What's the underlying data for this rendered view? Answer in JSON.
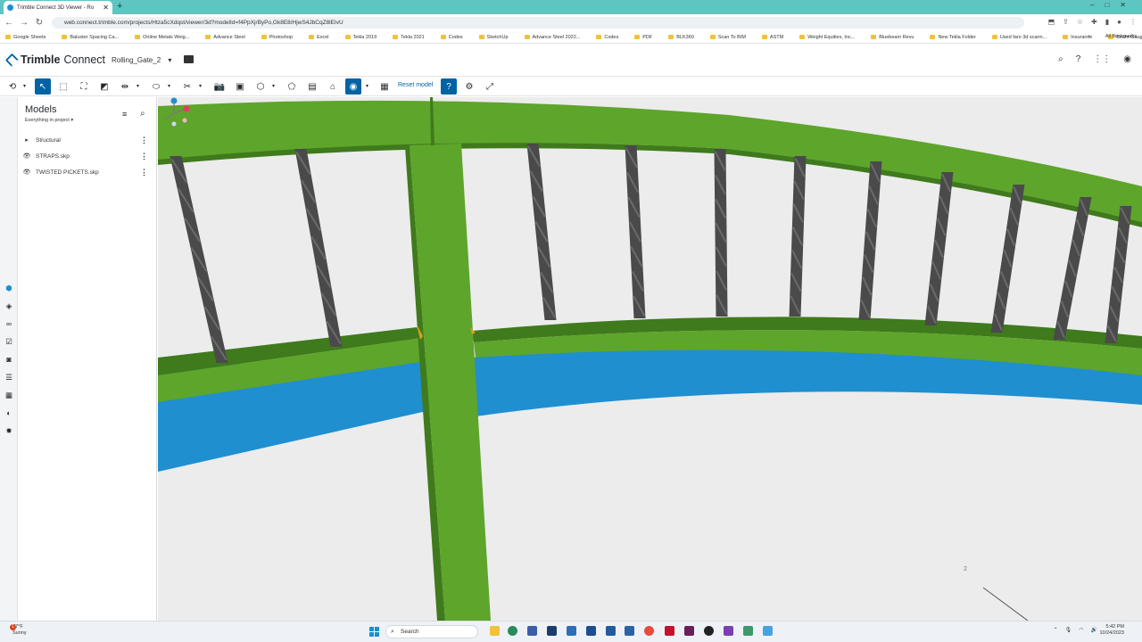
{
  "browser": {
    "tab_title": "Trimble Connect 3D Viewer - Ro",
    "tab_close": "✕",
    "new_tab": "+",
    "url": "web.connect.trimble.com/projects/Htza5cXdqst/viewer/3d?modelId=f4PpXjrByPo,Gk8E8/HjwS4JbCqZ8lEIvU",
    "bookmarks": [
      "Google Sheets",
      "Baluster Spacing Ca...",
      "Online Metals Weig...",
      "Advance Steel",
      "Photoshop",
      "Excel",
      "Tekla 2019",
      "Tekla 2021",
      "Codes",
      "SketchUp",
      "Advance Steel 2022...",
      "Codes",
      "PDF",
      "BLK360",
      "Scan To BIM",
      "ASTM",
      "Weight Equities, Inc...",
      "Bluebeam Revu",
      "New Tekla Folder",
      "Used faro 3d scann...",
      "Insurance",
      "Beam Gauge Lines"
    ],
    "all_bookmarks": "All Bookmarks",
    "bookmark_overflow": "»"
  },
  "app": {
    "brand_bold": "Trimble",
    "brand_rest": "Connect",
    "project_name": "Rolling_Gate_2",
    "project_caret": "▾",
    "reset_model": "Reset model"
  },
  "panel": {
    "title": "Models",
    "subtitle": "Everything in project",
    "subtitle_caret": "▾",
    "rows": [
      {
        "label": "Structural",
        "lead": "▸"
      },
      {
        "label": "STRAPS.skp",
        "lead": "👁"
      },
      {
        "label": "TWISTED PICKETS.skp",
        "lead": "👁"
      }
    ],
    "more": "⋮"
  },
  "viewport": {
    "axis_label": "2",
    "colors": {
      "frame": "#5ea52b",
      "frame_dark": "#3f7a1c",
      "rail_blue": "#1f8fcf",
      "picket": "#4a4a4a",
      "background": "#ececec"
    }
  },
  "taskbar": {
    "weather_temp": "77°F",
    "weather_desc": "Sunny",
    "weather_badge": "1",
    "search_label": "Search",
    "time": "5:42 PM",
    "date": "10/24/2023"
  }
}
